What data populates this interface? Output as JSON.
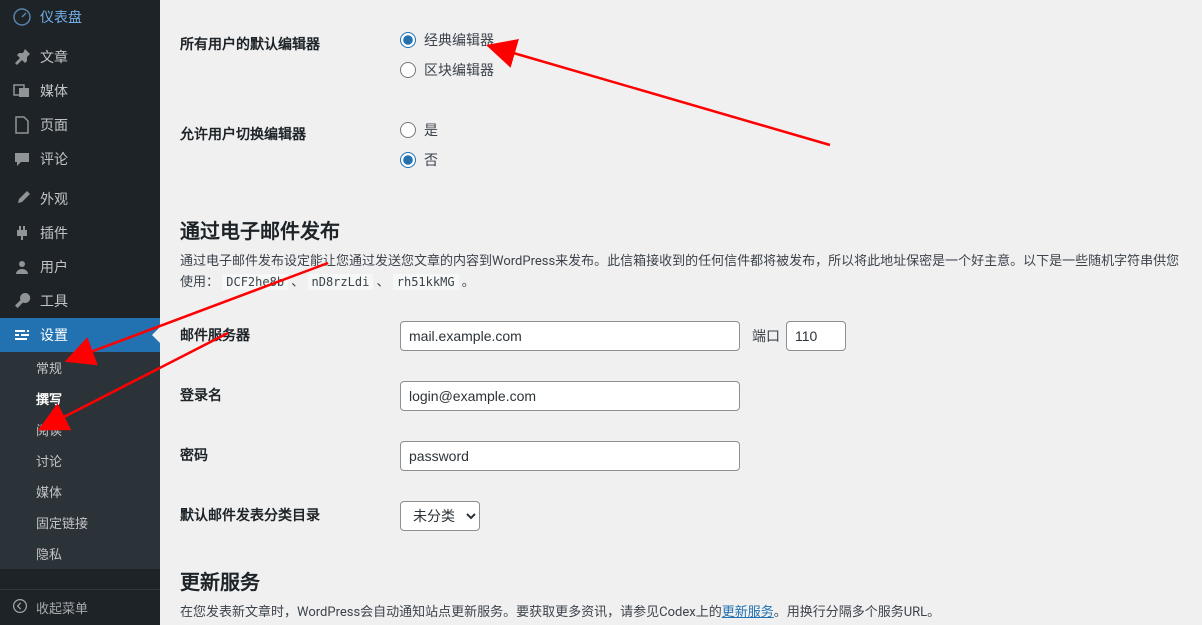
{
  "sidebar": {
    "items": [
      {
        "name": "dashboard",
        "label": "仪表盘"
      },
      {
        "name": "posts",
        "label": "文章"
      },
      {
        "name": "media",
        "label": "媒体"
      },
      {
        "name": "pages",
        "label": "页面"
      },
      {
        "name": "comments",
        "label": "评论"
      },
      {
        "name": "appearance",
        "label": "外观"
      },
      {
        "name": "plugins",
        "label": "插件"
      },
      {
        "name": "users",
        "label": "用户"
      },
      {
        "name": "tools",
        "label": "工具"
      },
      {
        "name": "settings",
        "label": "设置",
        "current": true
      }
    ],
    "submenu": [
      {
        "name": "general",
        "label": "常规"
      },
      {
        "name": "writing",
        "label": "撰写",
        "current": true
      },
      {
        "name": "reading",
        "label": "阅读"
      },
      {
        "name": "discussion",
        "label": "讨论"
      },
      {
        "name": "media-settings",
        "label": "媒体"
      },
      {
        "name": "permalinks",
        "label": "固定链接"
      },
      {
        "name": "privacy",
        "label": "隐私"
      }
    ],
    "collapse_label": "收起菜单"
  },
  "form": {
    "default_editor": {
      "label": "所有用户的默认编辑器",
      "options": {
        "classic": "经典编辑器",
        "block": "区块编辑器"
      },
      "selected": "classic"
    },
    "allow_switch": {
      "label": "允许用户切换编辑器",
      "options": {
        "yes": "是",
        "no": "否"
      },
      "selected": "no"
    },
    "email_post": {
      "title": "通过电子邮件发布",
      "desc_prefix": "通过电子邮件发布设定能让您通过发送您文章的内容到WordPress来发布。此信箱接收到的任何信件都将被发布，所以将此地址保密是一个好主意。以下是一些随机字符串供您使用：",
      "keys": [
        "DCF2he8b",
        "nD8rzLdi",
        "rh51kkMG"
      ],
      "sep": " 、 ",
      "suffix": " 。",
      "mail_server_label": "邮件服务器",
      "mail_server_value": "mail.example.com",
      "port_label": "端口",
      "port_value": "110",
      "login_label": "登录名",
      "login_value": "login@example.com",
      "password_label": "密码",
      "password_value": "password",
      "default_cat_label": "默认邮件发表分类目录",
      "default_cat_value": "未分类"
    },
    "update_services": {
      "title": "更新服务",
      "desc_before": "在您发表新文章时，WordPress会自动通知站点更新服务。要获取更多资讯，请参见Codex上的",
      "link_text": "更新服务",
      "desc_after": "。用换行分隔多个服务URL。"
    }
  }
}
